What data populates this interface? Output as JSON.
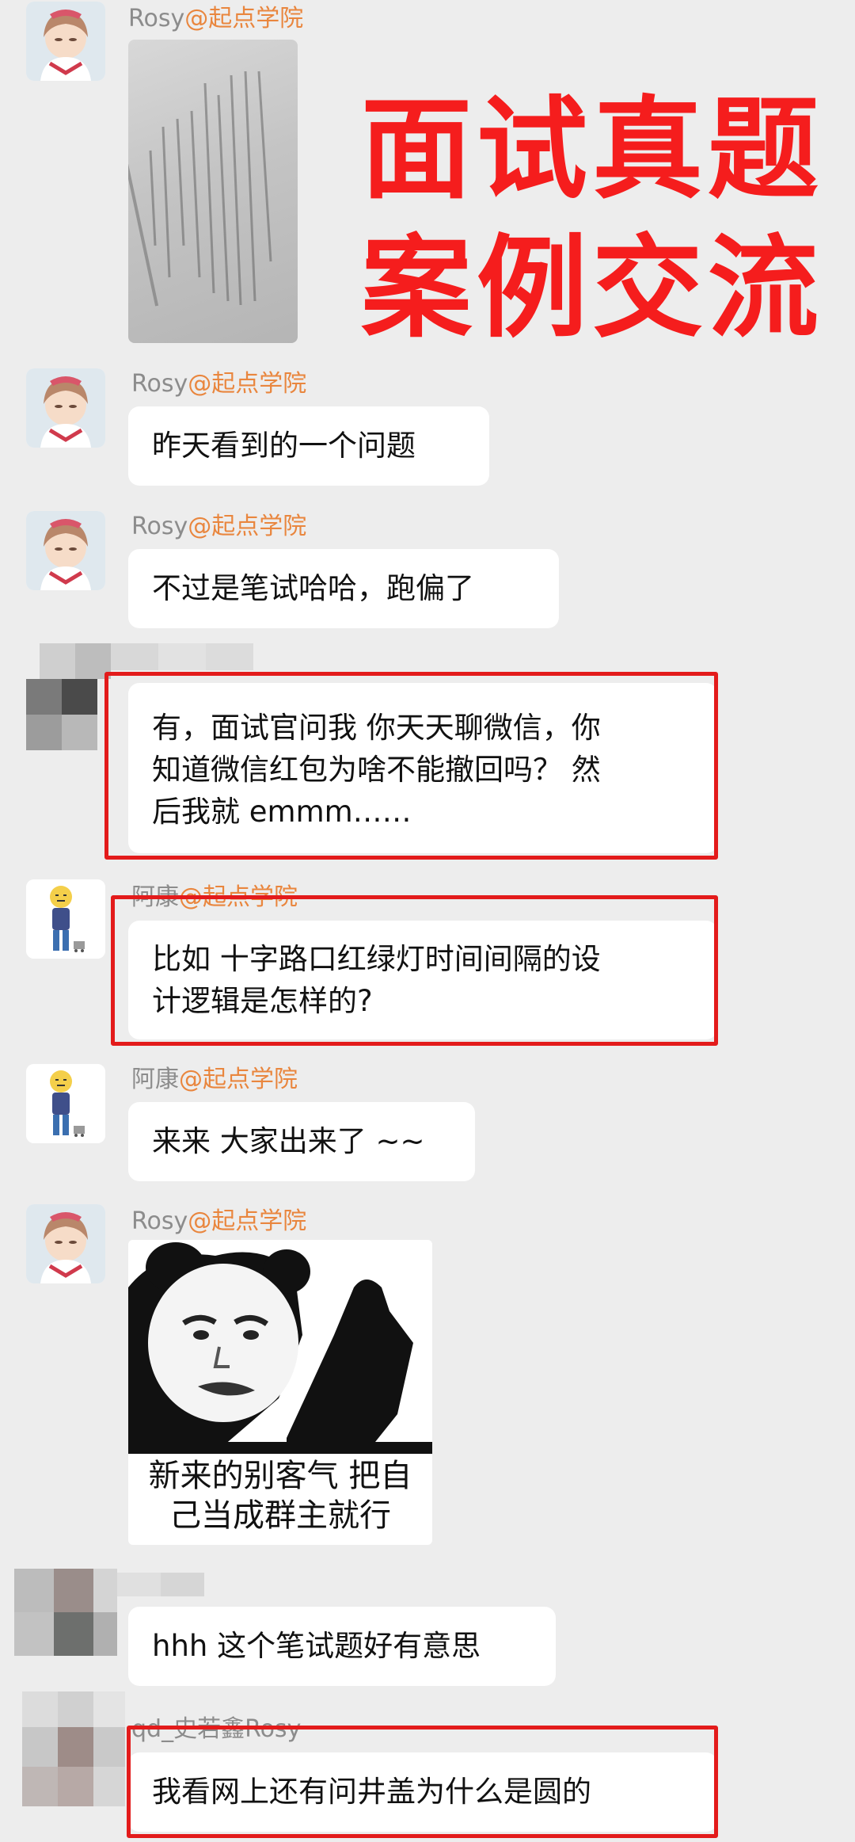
{
  "headline": {
    "line1": "面试真题",
    "line2": "案例交流"
  },
  "messages": [
    {
      "sender": "Rosy",
      "org": "@起点学院",
      "type": "image"
    },
    {
      "sender": "Rosy",
      "org": "@起点学院",
      "text": "昨天看到的一个问题"
    },
    {
      "sender": "Rosy",
      "org": "@起点学院",
      "text": "不过是笔试哈哈，跑偏了"
    },
    {
      "sender": "",
      "org": "",
      "lines": [
        "有，面试官问我  你天天聊微信，你",
        "知道微信红包为啥不能撤回吗？  然",
        "后我就 emmm……"
      ]
    },
    {
      "sender": "阿康",
      "org": "@起点学院",
      "lines": [
        "比如  十字路口红绿灯时间间隔的设",
        "计逻辑是怎样的?"
      ]
    },
    {
      "sender": "阿康",
      "org": "@起点学院",
      "text": "来来 大家出来了 ~~"
    },
    {
      "sender": "Rosy",
      "org": "@起点学院",
      "type": "meme",
      "caption": [
        "新来的别客气 把自",
        "己当成群主就行"
      ]
    },
    {
      "sender": "",
      "org": "",
      "text": "hhh 这个笔试题好有意思"
    },
    {
      "sender": "qd_史若鑫Rosy",
      "org": "",
      "text": "我看网上还有问井盖为什么是圆的"
    }
  ]
}
